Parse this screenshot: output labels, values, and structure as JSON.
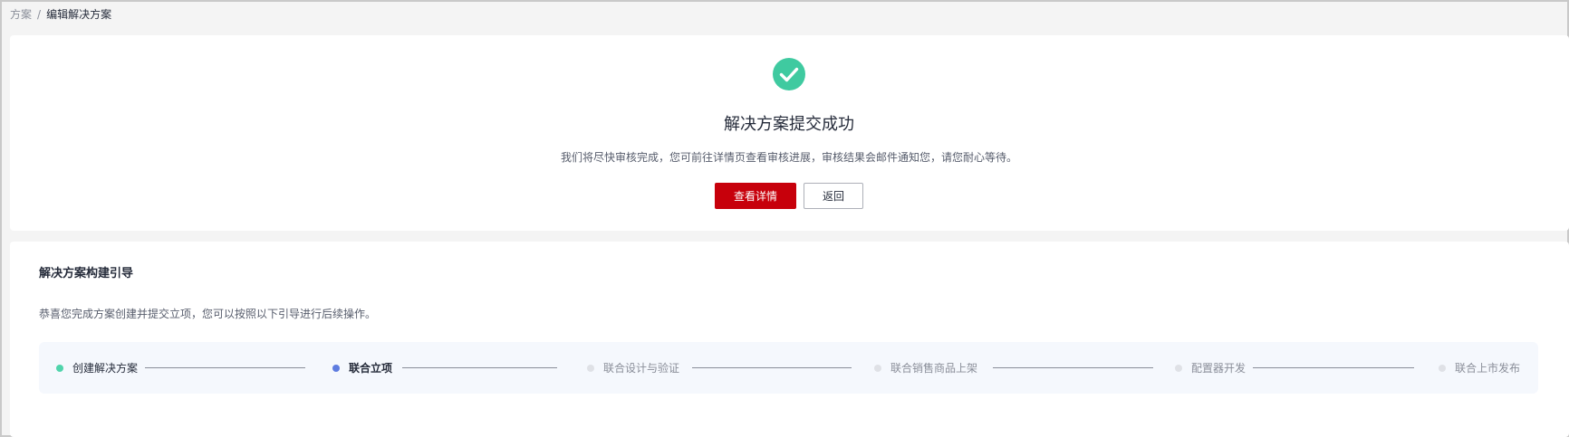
{
  "breadcrumb": {
    "parent": "方案",
    "separator": "/",
    "current": "编辑解决方案"
  },
  "result": {
    "icon": "check-circle-icon",
    "title": "解决方案提交成功",
    "description": "我们将尽快审核完成，您可前往详情页查看审核进展，审核结果会邮件通知您，请您耐心等待。",
    "primary_button": "查看详情",
    "secondary_button": "返回"
  },
  "guide": {
    "title": "解决方案构建引导",
    "description": "恭喜您完成方案创建并提交立项，您可以按照以下引导进行后续操作。",
    "steps": [
      {
        "label": "创建解决方案",
        "status": "done"
      },
      {
        "label": "联合立项",
        "status": "active"
      },
      {
        "label": "联合设计与验证",
        "status": "waiting"
      },
      {
        "label": "联合销售商品上架",
        "status": "waiting"
      },
      {
        "label": "配置器开发",
        "status": "waiting"
      },
      {
        "label": "联合上市发布",
        "status": "waiting"
      }
    ]
  },
  "colors": {
    "brand": "#c7000b",
    "success": "#3fcaa0",
    "active_step": "#5e7ce0"
  }
}
